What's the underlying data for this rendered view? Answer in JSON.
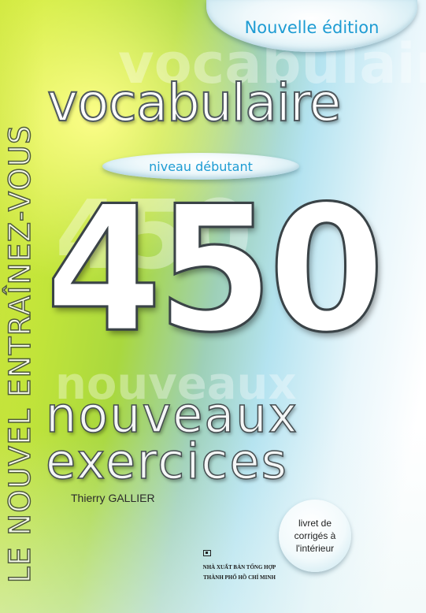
{
  "cover": {
    "series": "LE NOUVEL ENTRAÎNEZ-VOUS",
    "edition": "Nouvelle édition",
    "title": "vocabulaire",
    "level": "niveau débutant",
    "number": "450",
    "subtitle_line1": "nouveaux",
    "subtitle_line2": "exercices",
    "author": "Thierry GALLIER",
    "badge": "livret de\ncorrigés à\nl'intérieur",
    "publisher_line1": "NHÀ XUẤT BẢN TỔNG HỢP",
    "publisher_line2": "THÀNH PHỐ HỒ CHÍ MINH",
    "publisher_logo": "publisher-logo-icon"
  },
  "colors": {
    "accent_blue": "#1e9cd3",
    "lime": "#c2e53a",
    "outline": "#3a4347"
  }
}
